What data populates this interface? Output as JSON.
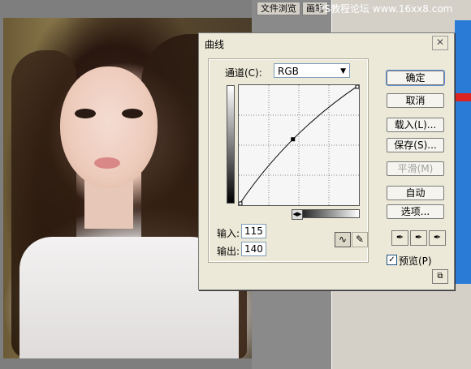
{
  "app": {
    "tabs": [
      {
        "label": "文件浏览"
      },
      {
        "label": "画笔"
      }
    ],
    "watermark": "PS教程论坛 www.16xx8.com"
  },
  "dialog": {
    "title": "曲线",
    "close_icon": "✕",
    "channel": {
      "label": "通道(C):",
      "value": "RGB"
    },
    "input": {
      "label": "输入:",
      "value": "115"
    },
    "output": {
      "label": "输出:",
      "value": "140"
    },
    "buttons": {
      "ok": "确定",
      "cancel": "取消",
      "load": "载入(L)...",
      "save": "保存(S)...",
      "smooth": "平滑(M)",
      "auto": "自动",
      "options": "选项..."
    },
    "preview": {
      "label": "预览(P)",
      "checked": true
    },
    "curve": {
      "control_point": {
        "input": 115,
        "output": 140
      },
      "grid_divisions": 4
    },
    "icons": {
      "curve_tool": "curve-tool-icon",
      "pencil_tool": "pencil-icon",
      "eyedroppers": [
        "black-eyedropper-icon",
        "gray-eyedropper-icon",
        "white-eyedropper-icon"
      ]
    }
  }
}
